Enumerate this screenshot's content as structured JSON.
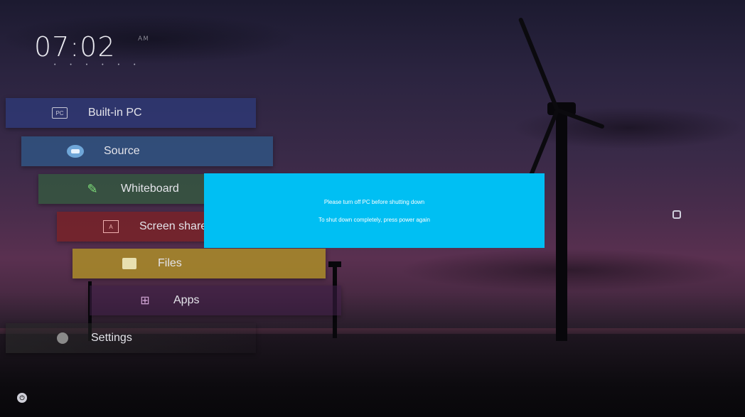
{
  "clock": {
    "time": "07:02",
    "ampm": "AM"
  },
  "menu": {
    "items": [
      {
        "label": "Built-in PC",
        "icon": "pc-icon",
        "icon_text": "PC"
      },
      {
        "label": "Source",
        "icon": "source-icon"
      },
      {
        "label": "Whiteboard",
        "icon": "pen-icon"
      },
      {
        "label": "Screen share",
        "icon": "screen-share-icon",
        "icon_text": "A"
      },
      {
        "label": "Files",
        "icon": "folder-icon"
      },
      {
        "label": "Apps",
        "icon": "apps-grid-icon"
      },
      {
        "label": "Settings",
        "icon": "gear-icon"
      }
    ]
  },
  "dialog": {
    "line1": "Please turn off PC before shutting down",
    "line2": "To shut down completely, press power again",
    "color": "#00bff3"
  }
}
